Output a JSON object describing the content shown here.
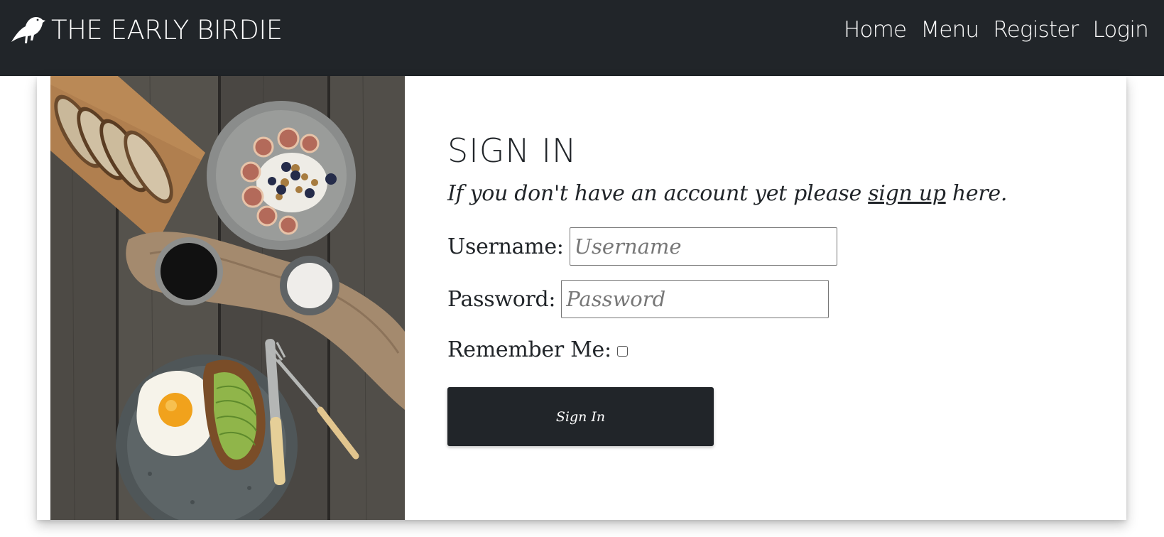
{
  "navbar": {
    "brand_icon": "bird-icon",
    "brand_title": "THE EARLY BIRDIE",
    "links": [
      "Home",
      "Menu",
      "Register",
      "Login"
    ]
  },
  "photo": {
    "subject": "breakfast-food-photo"
  },
  "form": {
    "title": "SIGN IN",
    "signup_prefix": "If you don't have an account yet please ",
    "signup_link": "sign up",
    "signup_suffix": " here.",
    "username_label": "Username:",
    "username_placeholder": "Username",
    "username_value": "",
    "password_label": "Password:",
    "password_placeholder": "Password",
    "password_value": "",
    "remember_label": "Remember Me:",
    "remember_checked": false,
    "submit_label": "Sign In"
  },
  "colors": {
    "navbar_bg": "#212529",
    "text": "#212529",
    "button_bg": "#212529",
    "button_text": "#ffffff"
  }
}
